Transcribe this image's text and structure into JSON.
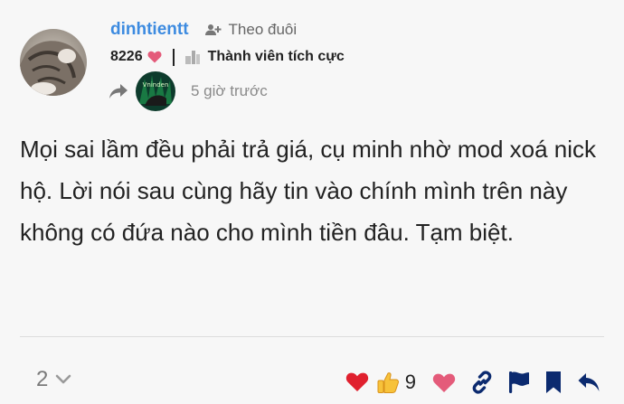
{
  "author": {
    "username": "dinhtientt",
    "follow_label": "Theo đuôi",
    "score": "8226",
    "badge": "Thành viên tích cực",
    "posted_ago": "5 giờ trước",
    "reply_to_avatar_text": "Vninden"
  },
  "post": {
    "text": "Mọi sai lầm đều phải trả giá, cụ minh nhờ mod xoá nick hộ. Lời nói sau cùng hãy tin vào chính mình trên này không có đứa nào cho mình tiền đâu. Tạm biệt."
  },
  "footer": {
    "reply_count": "2",
    "reaction_count": "9"
  },
  "colors": {
    "username": "#3d8be0",
    "heart": "#e45b7a",
    "action_icon": "#0b2a6f",
    "muted": "#8a8a8a"
  },
  "icons": {
    "follow": "user-plus-icon",
    "badge": "book-icon",
    "reply_to": "share-arrow-icon",
    "replies_toggle": "chevron-down-icon",
    "reactions": [
      "heart-emoji-icon",
      "thumbs-up-emoji-icon"
    ],
    "actions": [
      "heart-icon",
      "link-icon",
      "flag-icon",
      "bookmark-icon",
      "reply-icon"
    ]
  }
}
